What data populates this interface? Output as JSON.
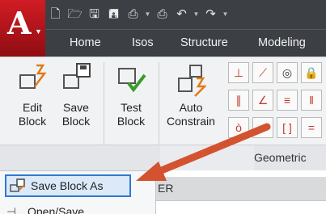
{
  "app": {
    "logo_letter": "A",
    "accent": "#c8161e"
  },
  "qat_icons": [
    "new-file-icon",
    "open-icon",
    "save-icon",
    "save-as-icon",
    "plot-icon",
    "print-icon",
    "undo-icon",
    "redo-icon"
  ],
  "tabs": [
    "Home",
    "Isos",
    "Structure",
    "Modeling"
  ],
  "ribbon": {
    "buttons": [
      {
        "line1": "Edit",
        "line2": "Block"
      },
      {
        "line1": "Save",
        "line2": "Block"
      },
      {
        "line1": "Test",
        "line2": "Block"
      },
      {
        "line1": "Auto",
        "line2": "Constrain"
      }
    ],
    "panel_label": "Geometric"
  },
  "dropdown": {
    "items": [
      {
        "label": "Save Block As"
      },
      {
        "label": "Open/Save"
      }
    ]
  },
  "right_pane": {
    "header_text": "ER"
  },
  "callout_color": "#d35230"
}
